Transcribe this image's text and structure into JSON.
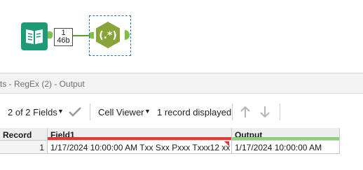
{
  "canvas": {
    "connection": {
      "records": "1",
      "size": "46b"
    },
    "regex_tool_glyph": "(.*)",
    "icons": {
      "input": "book-input-icon",
      "regex": "regex-hexagon-icon"
    }
  },
  "results": {
    "title": "ts - RegEx (2) - Output",
    "toolbar": {
      "fields_label": "2 of 2 Fields",
      "cell_viewer_label": "Cell Viewer",
      "records_label": "1 record displayed"
    },
    "grid": {
      "columns": [
        "Record",
        "Field1",
        "Output"
      ],
      "rows": [
        {
          "record": "1",
          "field1": "1/17/2024 10:00:00 AM Txx Sxx Pxxx Txxx12 xx",
          "output": "1/17/2024 10:00:00 AM"
        }
      ]
    },
    "colors": {
      "field1_bar": "#e53935",
      "output_bar": "#8bd17c",
      "anchor": "#7cc04b",
      "regex_tool": "#8aa43a"
    }
  }
}
